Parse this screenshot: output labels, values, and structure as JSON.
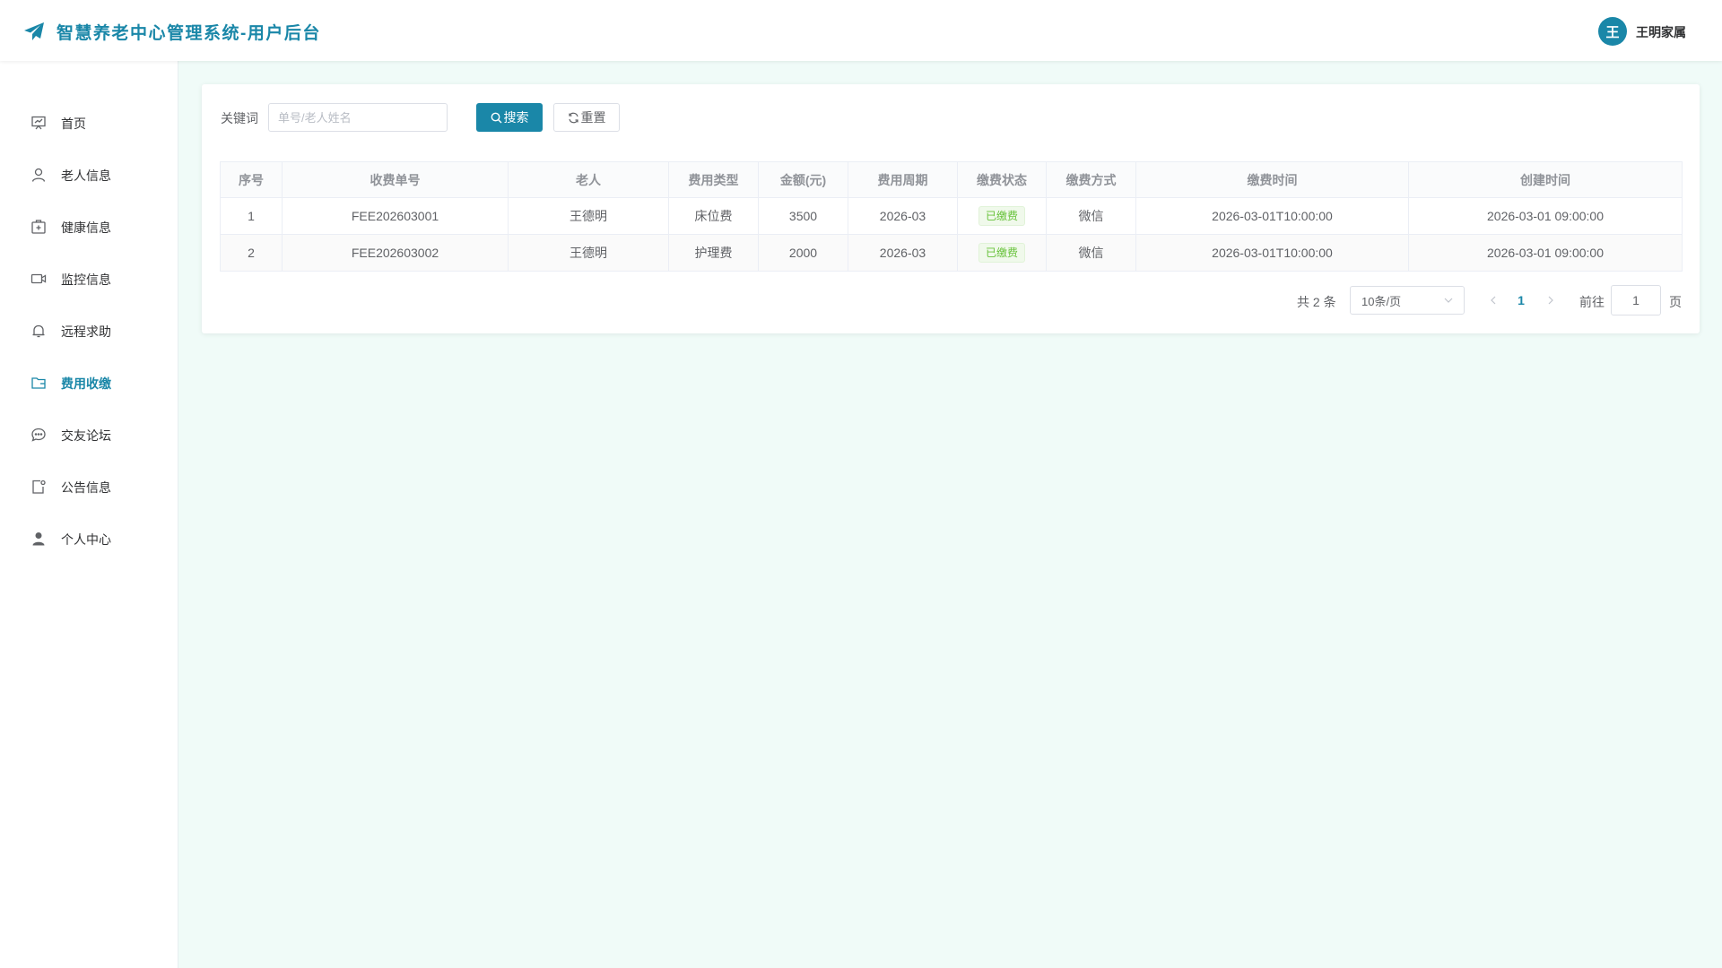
{
  "header": {
    "title": "智慧养老中心管理系统-用户后台",
    "avatar_text": "王",
    "user_name": "王明家属",
    "brand_color": "#1a87a8",
    "logo_icon": "paper-plane-icon"
  },
  "sidebar": {
    "items": [
      {
        "label": "首页",
        "icon": "presentation-icon",
        "active": false
      },
      {
        "label": "老人信息",
        "icon": "user-icon",
        "active": false
      },
      {
        "label": "健康信息",
        "icon": "first-aid-icon",
        "active": false
      },
      {
        "label": "监控信息",
        "icon": "video-camera-icon",
        "active": false
      },
      {
        "label": "远程求助",
        "icon": "bell-icon",
        "active": false
      },
      {
        "label": "费用收缴",
        "icon": "wallet-icon",
        "active": true
      },
      {
        "label": "交友论坛",
        "icon": "chat-icon",
        "active": false
      },
      {
        "label": "公告信息",
        "icon": "notice-icon",
        "active": false
      },
      {
        "label": "个人中心",
        "icon": "user-filled-icon",
        "active": false
      }
    ]
  },
  "search": {
    "label": "关键词",
    "placeholder": "单号/老人姓名",
    "value": "",
    "search_label": "搜索",
    "reset_label": "重置"
  },
  "table": {
    "columns": [
      "序号",
      "收费单号",
      "老人",
      "费用类型",
      "金额(元)",
      "费用周期",
      "缴费状态",
      "缴费方式",
      "缴费时间",
      "创建时间"
    ],
    "rows": [
      [
        "1",
        "FEE202603001",
        "王德明",
        "床位费",
        "3500",
        "2026-03",
        "已缴费",
        "微信",
        "2026-03-01T10:00:00",
        "2026-03-01 09:00:00"
      ],
      [
        "2",
        "FEE202603002",
        "王德明",
        "护理费",
        "2000",
        "2026-03",
        "已缴费",
        "微信",
        "2026-03-01T10:00:00",
        "2026-03-01 09:00:00"
      ]
    ]
  },
  "pagination": {
    "total_text": "共 2 条",
    "page_size": "10条/页",
    "current_page": "1",
    "goto_label": "前往",
    "goto_value": "1",
    "page_suffix": "页"
  }
}
